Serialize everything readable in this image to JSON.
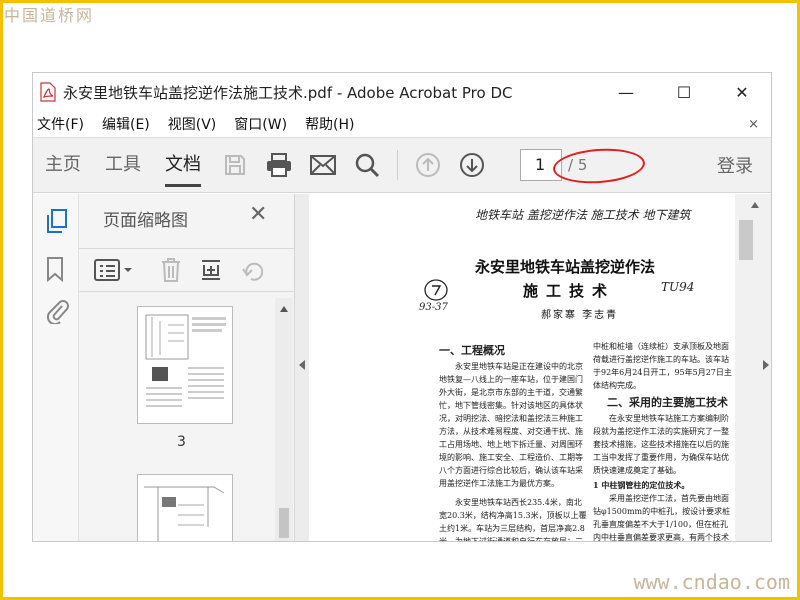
{
  "watermark_top": "中国道桥网",
  "watermark_bottom": "www.cndao.com",
  "window": {
    "title": "永安里地铁车站盖挖逆作法施工技术.pdf - Adobe Acrobat Pro DC",
    "controls": {
      "minimize": "—",
      "maximize": "☐",
      "close": "✕"
    }
  },
  "menu": [
    "文件(F)",
    "编辑(E)",
    "视图(V)",
    "窗口(W)",
    "帮助(H)"
  ],
  "menu_close": "×",
  "toolbar": {
    "tabs": [
      "主页",
      "工具",
      "文档"
    ],
    "page_current": "1",
    "page_total": "/ 5",
    "login": "登录"
  },
  "thumbnails": {
    "title": "页面缩略图",
    "page_label": "3"
  },
  "document": {
    "handwriting_top": "地铁车站  盖挖逆作法  施工技术  地下建筑",
    "handwriting_num": "93-37",
    "handwriting_code": "TU94",
    "title_line1": "永安里地铁车站盖挖逆作法",
    "title_line2": "施工技术",
    "authors": "郝家寨  李志青",
    "section1_heading": "一、工程概况",
    "section1_p1": "永安里地铁车站是正在建设中的北京地铁复—八线上的一座车站，位于建国门外大街，是北京市东部的主干道，交通繁忙，地下管线密集。针对该地区的具体状况，对明挖法、暗挖法和盖挖法三种施工方法，从技术难易程度、对交通干扰、施工占用场地、地上地下拆迁量、对周围环境的影响、施工安全、工程造价、工期等八个方面进行综合比较后，确认该车站采用盖挖逆作工法施工为最优方案。",
    "section1_p2": "永安里地铁车站西长235.4米，南北宽20.3米，结构净高15.3米，顶板以上覆土约1米。车站为三层结构，首层净高2.8米，为地下过街通道和自行车存放层；二层净高4.5米，为站厅层；三层净高6米，为站台层。",
    "right_p0": "中桩和桩墙（连续桩）支承顶板及地面荷载进行盖挖逆作施工的车站。该车站于92年6月24日开工，95年5月27日主体结构完成。",
    "section2_heading": "二、采用的主要施工技术",
    "section2_p1": "在永安里地铁车站施工方案编制阶段就为盖挖逆作工法的实施研究了一整套技术措施，这些技术措施在以后的施工当中发挥了重要作用，为确保车站优质快速建成奠定了基础。",
    "section2_sub": "1  中柱钢管柱的定位技术。",
    "section2_p2": "采用盖挖逆作工法，首先要由地面钻φ1500mm的中桩孔，按设计要求桩孔垂直度偏差不大于1/100，但在桩孔内中柱垂直偏差要求更高，有两个技术难点需要解决：一是如何保证φ600mm钢管柱的安装垂直偏差不大于设计要求的1/600，二是在底板以下φ1500mm桩孔中的钢管柱，应按设计"
  }
}
